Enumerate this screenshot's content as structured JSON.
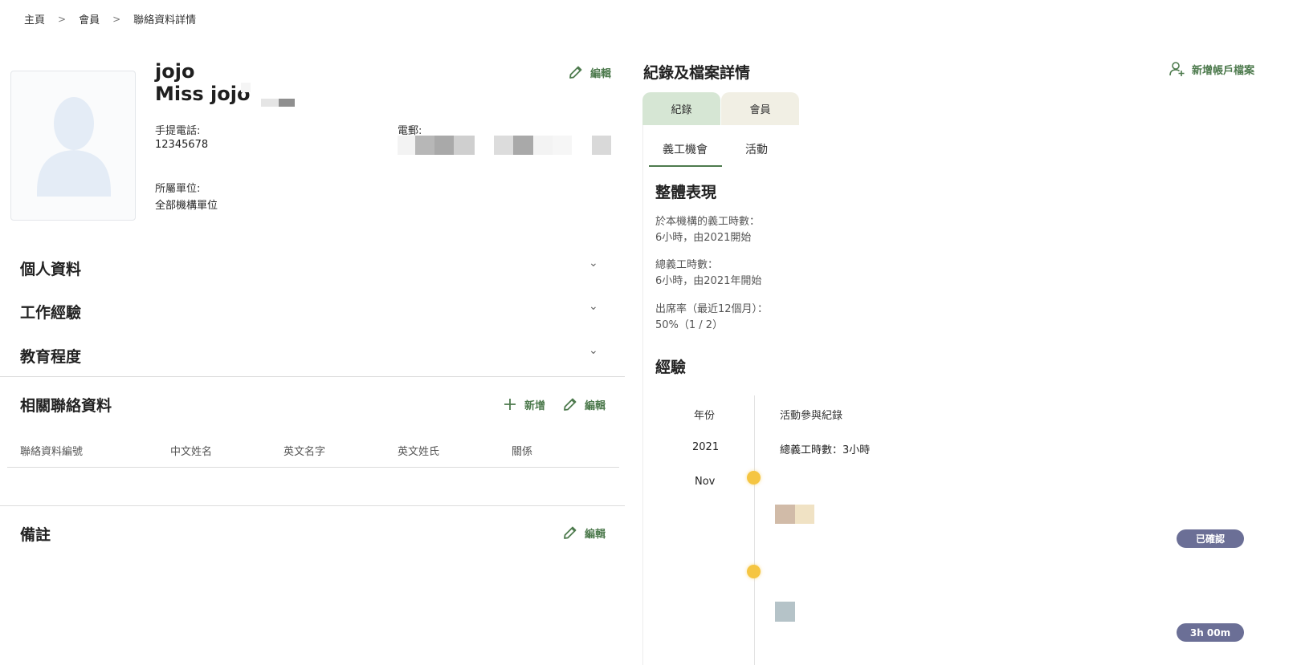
{
  "breadcrumb": {
    "home": "主頁",
    "members": "會員",
    "current": "聯絡資料詳情",
    "separator": ">"
  },
  "profile": {
    "display_name": "jojo",
    "full_name": "Miss jojo",
    "edit_label": "編輯",
    "mobile_label": "手提電話:",
    "mobile_value": "12345678",
    "email_label": "電郵:",
    "unit_label": "所屬單位:",
    "unit_value": "全部機構單位"
  },
  "sections": {
    "personal": "個人資料",
    "work": "工作經驗",
    "education": "教育程度",
    "chevron": "⌄"
  },
  "related": {
    "title": "相關聯絡資料",
    "add_label": "新增",
    "edit_label": "編輯",
    "columns": [
      "聯絡資料編號",
      "中文姓名",
      "英文名字",
      "英文姓氏",
      "關係"
    ]
  },
  "remarks": {
    "title": "備註",
    "edit_label": "編輯"
  },
  "right": {
    "title": "紀錄及檔案詳情",
    "add_account_label": "新增帳戶檔案",
    "tabs": [
      "紀錄",
      "會員"
    ],
    "subtabs": [
      "義工機會",
      "活動"
    ],
    "overall_title": "整體表現",
    "stats": [
      {
        "label": "於本機構的義工時數：",
        "value": "6小時，由2021開始"
      },
      {
        "label": "總義工時數：",
        "value": "6小時，由2021年開始"
      },
      {
        "label": "出席率（最近12個月）：",
        "value": "50%（1 / 2）"
      }
    ],
    "experience_title": "經驗",
    "timeline": {
      "year_header": "年份",
      "record_header": "活動參與紀錄",
      "year": "2021",
      "year_total": "總義工時數：3小時",
      "month": "Nov",
      "badge_confirmed": "已確認",
      "badge_hours": "3h 00m"
    }
  },
  "colors": {
    "accent_green": "#4d7a4d",
    "tab_active": "#d6e6d4",
    "tab_inactive": "#f1efe4",
    "timeline_dot": "#f5c542",
    "badge": "#6b6f96"
  }
}
